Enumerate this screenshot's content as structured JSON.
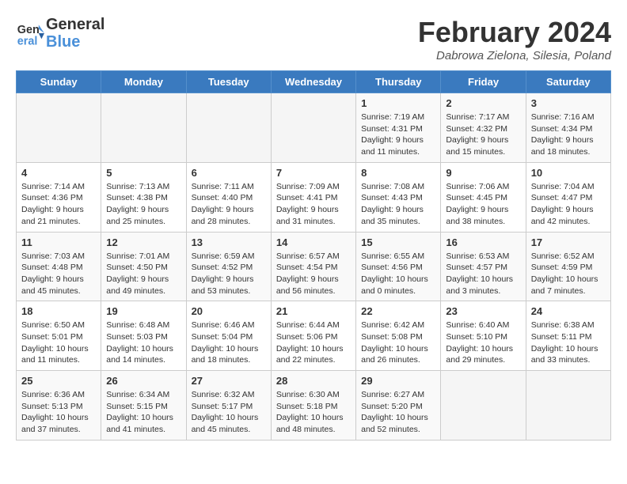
{
  "header": {
    "logo_line1": "General",
    "logo_line2": "Blue",
    "month": "February 2024",
    "location": "Dabrowa Zielona, Silesia, Poland"
  },
  "weekdays": [
    "Sunday",
    "Monday",
    "Tuesday",
    "Wednesday",
    "Thursday",
    "Friday",
    "Saturday"
  ],
  "weeks": [
    [
      {
        "day": "",
        "info": ""
      },
      {
        "day": "",
        "info": ""
      },
      {
        "day": "",
        "info": ""
      },
      {
        "day": "",
        "info": ""
      },
      {
        "day": "1",
        "info": "Sunrise: 7:19 AM\nSunset: 4:31 PM\nDaylight: 9 hours\nand 11 minutes."
      },
      {
        "day": "2",
        "info": "Sunrise: 7:17 AM\nSunset: 4:32 PM\nDaylight: 9 hours\nand 15 minutes."
      },
      {
        "day": "3",
        "info": "Sunrise: 7:16 AM\nSunset: 4:34 PM\nDaylight: 9 hours\nand 18 minutes."
      }
    ],
    [
      {
        "day": "4",
        "info": "Sunrise: 7:14 AM\nSunset: 4:36 PM\nDaylight: 9 hours\nand 21 minutes."
      },
      {
        "day": "5",
        "info": "Sunrise: 7:13 AM\nSunset: 4:38 PM\nDaylight: 9 hours\nand 25 minutes."
      },
      {
        "day": "6",
        "info": "Sunrise: 7:11 AM\nSunset: 4:40 PM\nDaylight: 9 hours\nand 28 minutes."
      },
      {
        "day": "7",
        "info": "Sunrise: 7:09 AM\nSunset: 4:41 PM\nDaylight: 9 hours\nand 31 minutes."
      },
      {
        "day": "8",
        "info": "Sunrise: 7:08 AM\nSunset: 4:43 PM\nDaylight: 9 hours\nand 35 minutes."
      },
      {
        "day": "9",
        "info": "Sunrise: 7:06 AM\nSunset: 4:45 PM\nDaylight: 9 hours\nand 38 minutes."
      },
      {
        "day": "10",
        "info": "Sunrise: 7:04 AM\nSunset: 4:47 PM\nDaylight: 9 hours\nand 42 minutes."
      }
    ],
    [
      {
        "day": "11",
        "info": "Sunrise: 7:03 AM\nSunset: 4:48 PM\nDaylight: 9 hours\nand 45 minutes."
      },
      {
        "day": "12",
        "info": "Sunrise: 7:01 AM\nSunset: 4:50 PM\nDaylight: 9 hours\nand 49 minutes."
      },
      {
        "day": "13",
        "info": "Sunrise: 6:59 AM\nSunset: 4:52 PM\nDaylight: 9 hours\nand 53 minutes."
      },
      {
        "day": "14",
        "info": "Sunrise: 6:57 AM\nSunset: 4:54 PM\nDaylight: 9 hours\nand 56 minutes."
      },
      {
        "day": "15",
        "info": "Sunrise: 6:55 AM\nSunset: 4:56 PM\nDaylight: 10 hours\nand 0 minutes."
      },
      {
        "day": "16",
        "info": "Sunrise: 6:53 AM\nSunset: 4:57 PM\nDaylight: 10 hours\nand 3 minutes."
      },
      {
        "day": "17",
        "info": "Sunrise: 6:52 AM\nSunset: 4:59 PM\nDaylight: 10 hours\nand 7 minutes."
      }
    ],
    [
      {
        "day": "18",
        "info": "Sunrise: 6:50 AM\nSunset: 5:01 PM\nDaylight: 10 hours\nand 11 minutes."
      },
      {
        "day": "19",
        "info": "Sunrise: 6:48 AM\nSunset: 5:03 PM\nDaylight: 10 hours\nand 14 minutes."
      },
      {
        "day": "20",
        "info": "Sunrise: 6:46 AM\nSunset: 5:04 PM\nDaylight: 10 hours\nand 18 minutes."
      },
      {
        "day": "21",
        "info": "Sunrise: 6:44 AM\nSunset: 5:06 PM\nDaylight: 10 hours\nand 22 minutes."
      },
      {
        "day": "22",
        "info": "Sunrise: 6:42 AM\nSunset: 5:08 PM\nDaylight: 10 hours\nand 26 minutes."
      },
      {
        "day": "23",
        "info": "Sunrise: 6:40 AM\nSunset: 5:10 PM\nDaylight: 10 hours\nand 29 minutes."
      },
      {
        "day": "24",
        "info": "Sunrise: 6:38 AM\nSunset: 5:11 PM\nDaylight: 10 hours\nand 33 minutes."
      }
    ],
    [
      {
        "day": "25",
        "info": "Sunrise: 6:36 AM\nSunset: 5:13 PM\nDaylight: 10 hours\nand 37 minutes."
      },
      {
        "day": "26",
        "info": "Sunrise: 6:34 AM\nSunset: 5:15 PM\nDaylight: 10 hours\nand 41 minutes."
      },
      {
        "day": "27",
        "info": "Sunrise: 6:32 AM\nSunset: 5:17 PM\nDaylight: 10 hours\nand 45 minutes."
      },
      {
        "day": "28",
        "info": "Sunrise: 6:30 AM\nSunset: 5:18 PM\nDaylight: 10 hours\nand 48 minutes."
      },
      {
        "day": "29",
        "info": "Sunrise: 6:27 AM\nSunset: 5:20 PM\nDaylight: 10 hours\nand 52 minutes."
      },
      {
        "day": "",
        "info": ""
      },
      {
        "day": "",
        "info": ""
      }
    ]
  ]
}
